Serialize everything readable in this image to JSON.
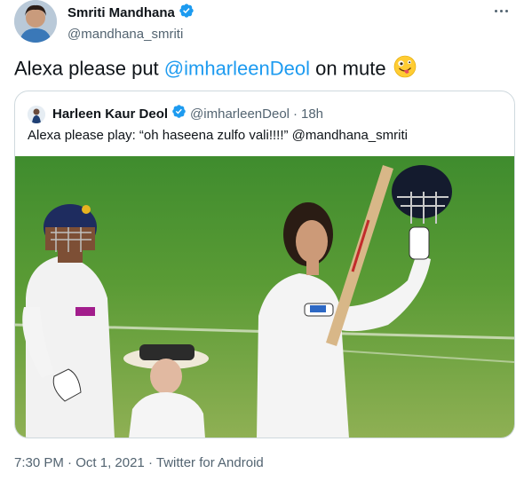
{
  "tweet": {
    "author_name": "Smriti Mandhana",
    "author_handle": "@mandhana_smriti",
    "text_before": "Alexa please put ",
    "mention": "@imharleenDeol",
    "text_after": " on mute",
    "emoji": "zany-face-emoji",
    "time": "7:30 PM",
    "date": "Oct 1, 2021",
    "source": "Twitter for Android",
    "separator": "·"
  },
  "quoted": {
    "author_name": "Harleen Kaur Deol",
    "author_handle": "@imharleenDeol",
    "separator": "·",
    "age": "18h",
    "text": "Alexa please play: “oh haseena zulfo vali!!!!” @mandhana_smriti"
  },
  "colors": {
    "accent": "#1d9bf0",
    "muted": "#536471",
    "verified": "#1d9bf0",
    "border": "#cfd9de"
  },
  "icons": [
    "verified-badge-icon",
    "more-options-icon"
  ]
}
